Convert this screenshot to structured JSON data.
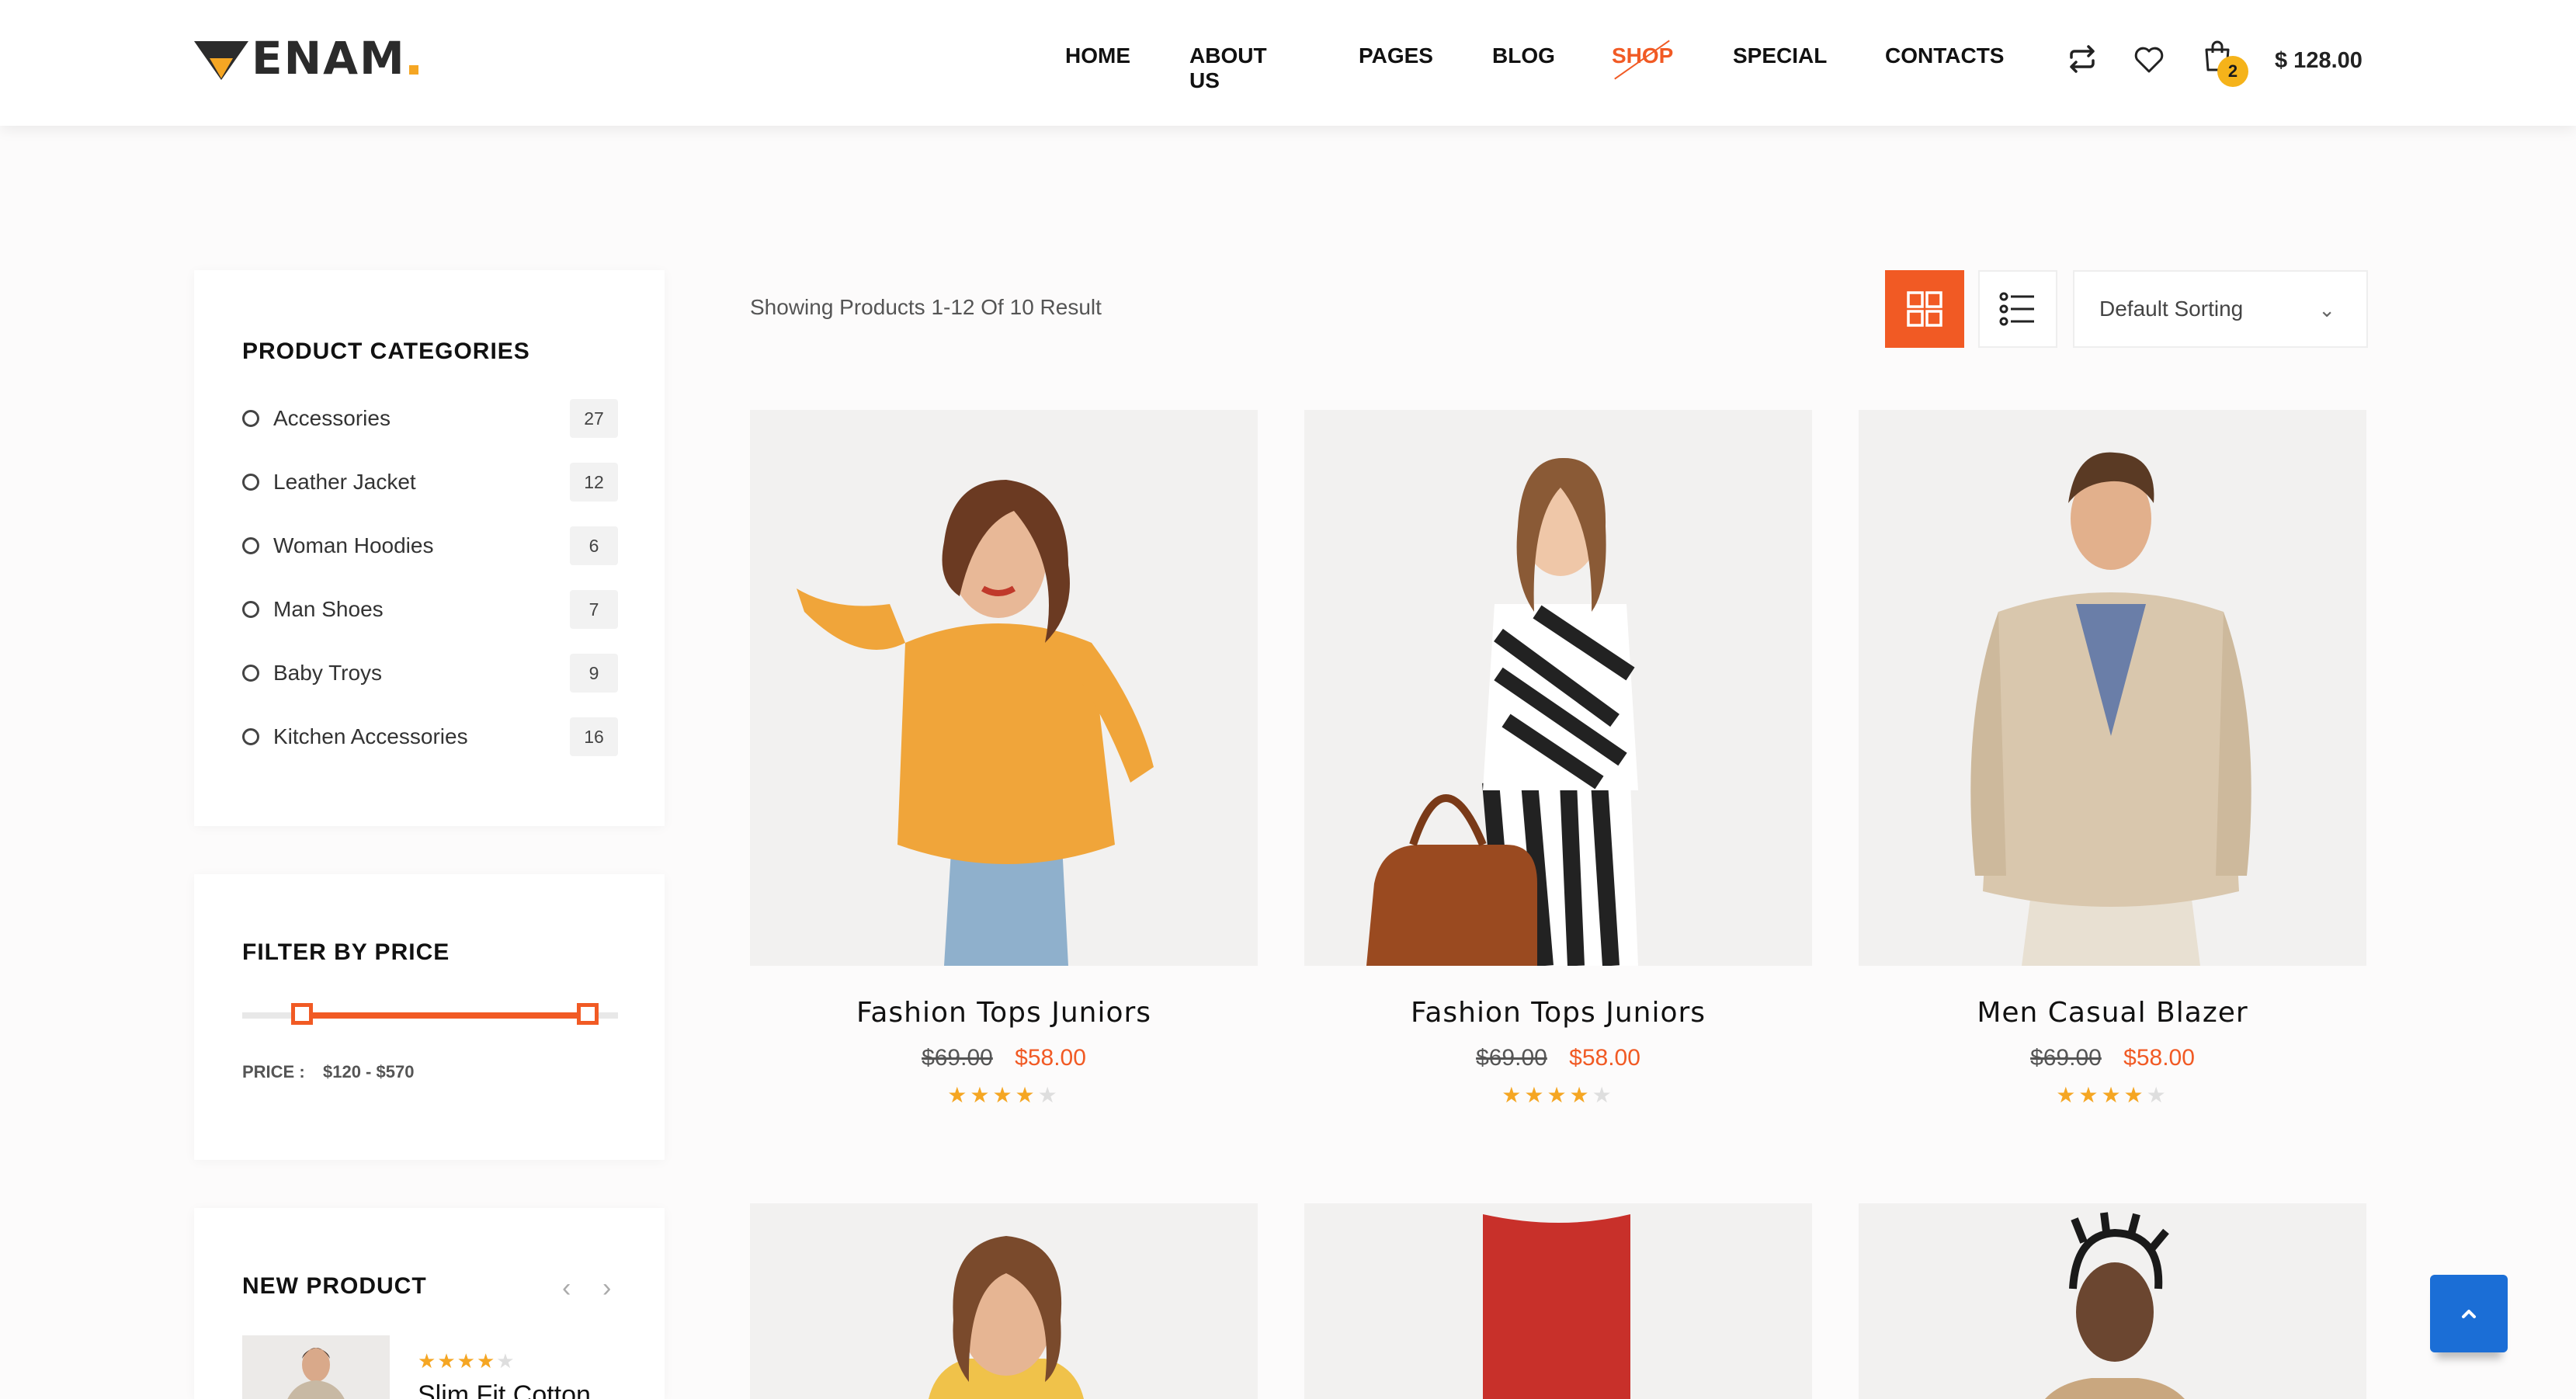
{
  "header": {
    "logo_text": "ENAM",
    "nav": [
      "HOME",
      "ABOUT US",
      "PAGES",
      "BLOG",
      "SHOP",
      "SPECIAL",
      "CONTACTS"
    ],
    "cart_count": "2",
    "cart_total": "$ 128.00"
  },
  "sidebar": {
    "categories_title": "PRODUCT CATEGORIES",
    "categories": [
      {
        "label": "Accessories",
        "count": "27"
      },
      {
        "label": "Leather Jacket",
        "count": "12"
      },
      {
        "label": "Woman Hoodies",
        "count": "6"
      },
      {
        "label": "Man Shoes",
        "count": "7"
      },
      {
        "label": "Baby Troys",
        "count": "9"
      },
      {
        "label": "Kitchen Accessories",
        "count": "16"
      }
    ],
    "price_title": "FILTER BY PRICE",
    "price_label": "PRICE :",
    "price_range": "$120 - $570",
    "price_slider": {
      "min_fraction": 0.16,
      "max_fraction": 0.92
    },
    "new_product_title": "NEW PRODUCT",
    "new_product": {
      "title": "Slim Fit Cotton",
      "rating": 4
    }
  },
  "toolbar": {
    "showing": "Showing Products 1-12 Of 10 Result",
    "sort_value": "Default Sorting"
  },
  "products": [
    {
      "title": "Fashion Tops Juniors",
      "old_price": "$69.00",
      "price": "$58.00",
      "rating": 4
    },
    {
      "title": "Fashion Tops Juniors",
      "old_price": "$69.00",
      "price": "$58.00",
      "rating": 4
    },
    {
      "title": "Men Casual Blazer",
      "old_price": "$69.00",
      "price": "$58.00",
      "rating": 4
    }
  ],
  "colors": {
    "accent": "#f15a24",
    "star": "#f5a623",
    "badge": "#f5b31a",
    "scroll_top": "#1b6ed6"
  },
  "icons": [
    "compare-icon",
    "heart-icon",
    "cart-icon",
    "grid-view-icon",
    "list-view-icon",
    "chevron-down-icon",
    "chevron-left-icon",
    "chevron-right-icon",
    "arrow-up-icon"
  ]
}
